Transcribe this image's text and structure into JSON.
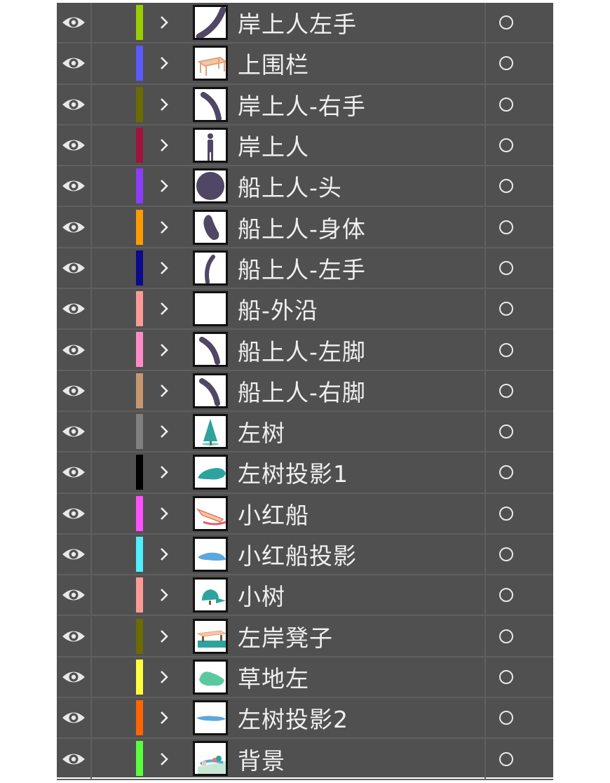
{
  "layers": [
    {
      "name": "岸上人左手",
      "color": "#9acd00",
      "thumb": "arm-left"
    },
    {
      "name": "上围栏",
      "color": "#5a5aff",
      "thumb": "fence"
    },
    {
      "name": "岸上人-右手",
      "color": "#6b6b00",
      "thumb": "arm-right"
    },
    {
      "name": "岸上人",
      "color": "#a0143c",
      "thumb": "person"
    },
    {
      "name": "船上人-头",
      "color": "#8c3cff",
      "thumb": "head"
    },
    {
      "name": "船上人-身体",
      "color": "#ff9a00",
      "thumb": "body"
    },
    {
      "name": "船上人-左手",
      "color": "#0a0a8c",
      "thumb": "hand"
    },
    {
      "name": "船-外沿",
      "color": "#ff9a96",
      "thumb": "blank"
    },
    {
      "name": "船上人-左脚",
      "color": "#ff8cc8",
      "thumb": "leg"
    },
    {
      "name": "船上人-右脚",
      "color": "#c8966e",
      "thumb": "leg"
    },
    {
      "name": "左树",
      "color": "#808080",
      "thumb": "tree"
    },
    {
      "name": "左树投影1",
      "color": "#000000",
      "thumb": "shadow-teal"
    },
    {
      "name": "小红船",
      "color": "#ff50ff",
      "thumb": "boat"
    },
    {
      "name": "小红船投影",
      "color": "#50f0ff",
      "thumb": "shadow-blue"
    },
    {
      "name": "小树",
      "color": "#ff9a96",
      "thumb": "small-tree"
    },
    {
      "name": "左岸凳子",
      "color": "#6b6b00",
      "thumb": "bench"
    },
    {
      "name": "草地左",
      "color": "#ffff3c",
      "thumb": "grass"
    },
    {
      "name": "左树投影2",
      "color": "#ff6400",
      "thumb": "shadow-blue2"
    },
    {
      "name": "背景",
      "color": "#5aff3c",
      "thumb": "background"
    }
  ]
}
